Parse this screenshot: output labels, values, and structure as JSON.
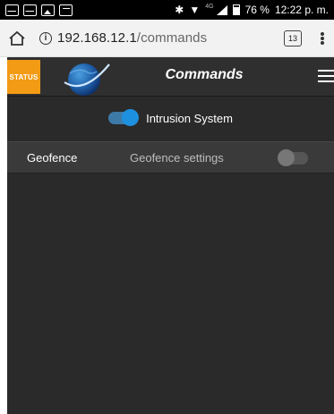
{
  "statusbar": {
    "left_icons": [
      "mail-icon",
      "mail-icon",
      "image-icon",
      "app-icon",
      "pulse-icon"
    ],
    "bluetooth": "✱",
    "wifi": "▼",
    "network_label": "4G",
    "battery_percent": "76 %",
    "battery_level": 0.76,
    "time": "12:22 p. m."
  },
  "browser": {
    "url_host": "192.168.12.1",
    "url_path": "/commands",
    "tab_count": "13"
  },
  "app": {
    "status_label": "STATUS",
    "title": "Commands",
    "intrusion": {
      "label": "Intrusion System",
      "enabled": true
    },
    "geofence": {
      "label": "Geofence",
      "settings_label": "Geofence settings",
      "enabled": false
    }
  },
  "colors": {
    "status_orange": "#f39b14",
    "toggle_blue": "#1e90e0",
    "app_bg": "#2a2a2a"
  }
}
